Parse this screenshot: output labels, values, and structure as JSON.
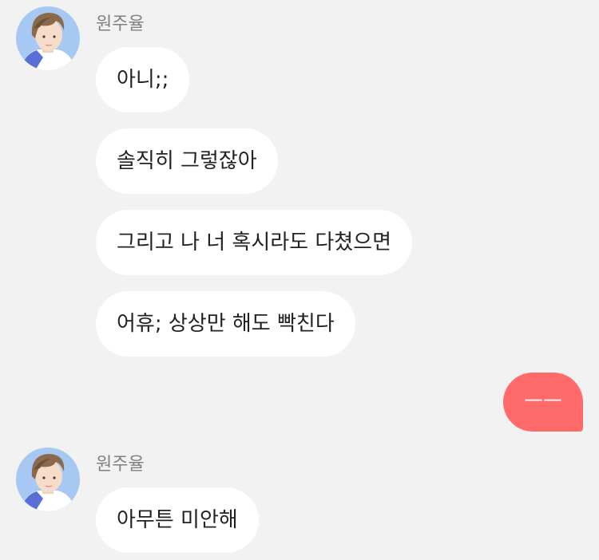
{
  "messages": [
    {
      "sender": "원주율",
      "bubbles": [
        "아니;;",
        "솔직히 그렇잖아",
        "그리고 나 너 혹시라도 다쳤으면",
        "어휴; 상상만 해도 빡친다"
      ]
    },
    {
      "outgoing": "ㅡㅡ"
    },
    {
      "sender": "원주율",
      "bubbles": [
        "아무튼 미안해"
      ]
    }
  ],
  "colors": {
    "background": "#f2f2f2",
    "incoming_bubble": "#ffffff",
    "outgoing_bubble": "#ff6b6b",
    "sender_name": "#808080"
  },
  "icons": {
    "avatar": "avatar-portrait-icon"
  }
}
